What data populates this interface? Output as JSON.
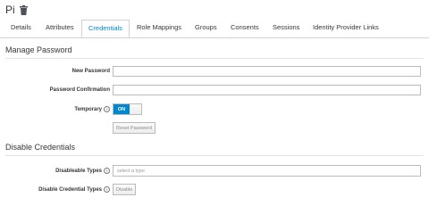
{
  "header": {
    "title": "Pi",
    "delete_icon": "trash-icon"
  },
  "tabs": [
    {
      "label": "Details"
    },
    {
      "label": "Attributes"
    },
    {
      "label": "Credentials",
      "active": true
    },
    {
      "label": "Role Mappings"
    },
    {
      "label": "Groups"
    },
    {
      "label": "Consents"
    },
    {
      "label": "Sessions"
    },
    {
      "label": "Identity Provider Links"
    }
  ],
  "manage_password": {
    "title": "Manage Password",
    "new_password_label": "New Password",
    "new_password_value": "",
    "confirmation_label": "Password Confirmation",
    "confirmation_value": "",
    "temporary_label": "Temporary",
    "temporary_state": "ON",
    "reset_button": "Reset Password"
  },
  "disable_credentials": {
    "title": "Disable Credentials",
    "disableable_label": "Disableable Types",
    "disableable_placeholder": "select a type",
    "disable_types_label": "Disable Credential Types",
    "disable_button": "Disable"
  },
  "colors": {
    "accent": "#0088ce",
    "border": "#d1d1d1"
  }
}
